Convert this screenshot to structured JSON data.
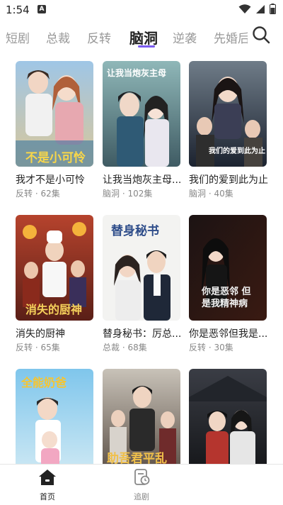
{
  "status_bar": {
    "time": "1:54",
    "badge": "A"
  },
  "tabs": [
    {
      "label": "短剧"
    },
    {
      "label": "总裁"
    },
    {
      "label": "反转"
    },
    {
      "label": "脑洞",
      "active": true
    },
    {
      "label": "逆袭"
    },
    {
      "label": "先婚后"
    }
  ],
  "icons": {
    "search": "search-icon",
    "home": "home-icon",
    "follow": "clock-doc-icon"
  },
  "colors": {
    "accent": "#7b5cf0",
    "nav_active": "#222222",
    "nav_inactive": "#888888"
  },
  "dramas": [
    {
      "title": "我才不是小可怜",
      "genre": "反转",
      "episodes": "62集",
      "cover_text": "不是小可怜"
    },
    {
      "title": "让我当炮灰主母...",
      "genre": "脑洞",
      "episodes": "102集",
      "cover_text": "让我当炮灰主母"
    },
    {
      "title": "我们的爱到此为止",
      "genre": "脑洞",
      "episodes": "40集",
      "cover_text": "我们的爱到此为止"
    },
    {
      "title": "消失的厨神",
      "genre": "反转",
      "episodes": "65集",
      "cover_text": "消失的厨神"
    },
    {
      "title": "替身秘书：厉总...",
      "genre": "总裁",
      "episodes": "68集",
      "cover_text": "替身秘书"
    },
    {
      "title": "你是恶邻但我是...",
      "genre": "反转",
      "episodes": "30集",
      "cover_text": "你是恶邻 但是我精神病"
    },
    {
      "title": "",
      "genre": "",
      "episodes": "",
      "cover_text": "全能奶爸"
    },
    {
      "title": "",
      "genre": "",
      "episodes": "",
      "cover_text": "助吾君平乱"
    },
    {
      "title": "",
      "genre": "",
      "episodes": "",
      "cover_text": ""
    }
  ],
  "bottom_nav": [
    {
      "label": "首页",
      "active": true
    },
    {
      "label": "追剧",
      "active": false
    }
  ]
}
